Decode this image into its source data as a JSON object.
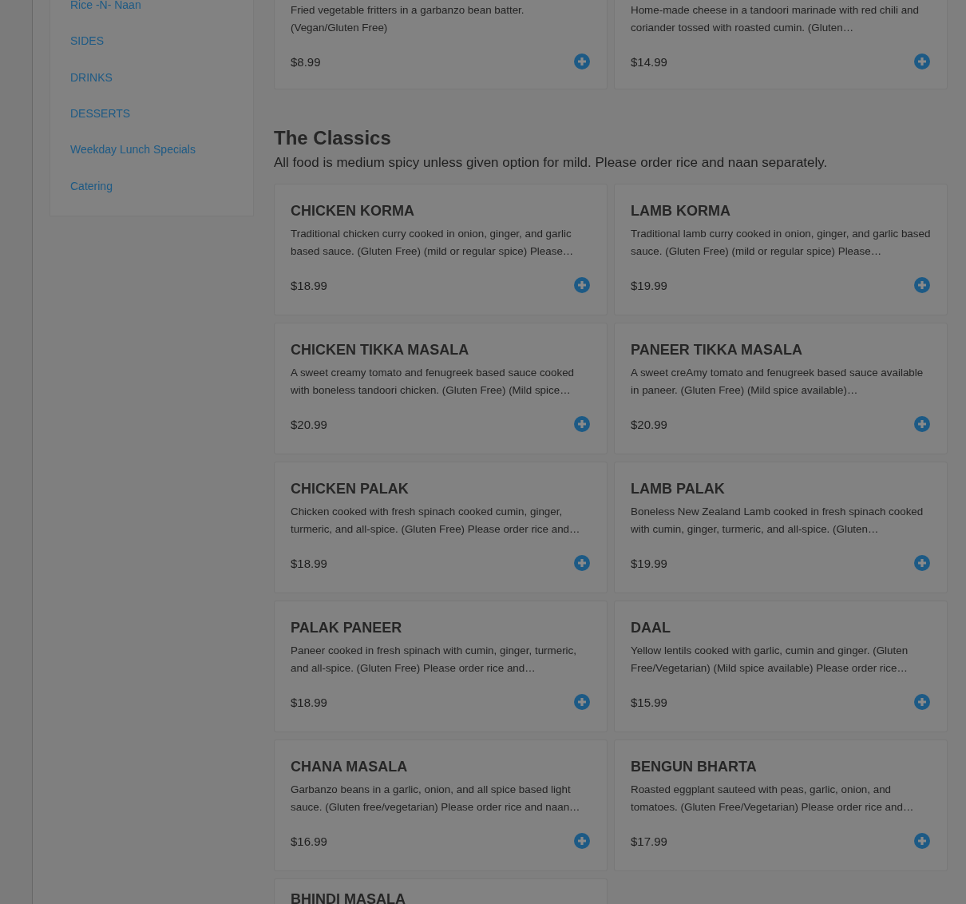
{
  "sidebar": {
    "items": [
      {
        "label": "Rice -N- Naan"
      },
      {
        "label": "SIDES"
      },
      {
        "label": "DRINKS"
      },
      {
        "label": "DESSERTS"
      },
      {
        "label": "Weekday Lunch Specials"
      },
      {
        "label": "Catering"
      }
    ]
  },
  "top_items": [
    {
      "description": "Fried vegetable fritters in a garbanzo bean batter. (Vegan/Gluten Free)",
      "price": "$8.99"
    },
    {
      "description": "Home-made cheese in a tandoori marinade with red chili and coriander tossed with roasted cumin. (Gluten…",
      "price": "$14.99"
    }
  ],
  "section": {
    "title": "The Classics",
    "subtitle": "All food is medium spicy unless given option for mild. Please order rice and naan separately.",
    "items": [
      {
        "name": "CHICKEN KORMA",
        "description": "Traditional chicken curry cooked in onion, ginger, and garlic based sauce. (Gluten Free) (mild or regular spice) Please…",
        "price": "$18.99"
      },
      {
        "name": "LAMB KORMA",
        "description": "Traditional lamb curry cooked in onion, ginger, and garlic based sauce. (Gluten Free) (mild or regular spice) Please…",
        "price": "$19.99"
      },
      {
        "name": "CHICKEN TIKKA MASALA",
        "description": "A sweet creamy tomato and fenugreek based sauce cooked with boneless tandoori chicken. (Gluten Free) (Mild spice…",
        "price": "$20.99"
      },
      {
        "name": "PANEER TIKKA MASALA",
        "description": "A sweet creAmy tomato and fenugreek based sauce available in paneer. (Gluten Free) (Mild spice available)…",
        "price": "$20.99"
      },
      {
        "name": "CHICKEN PALAK",
        "description": "Chicken cooked with fresh spinach cooked cumin, ginger, turmeric, and all-spice. (Gluten Free) Please order rice and…",
        "price": "$18.99"
      },
      {
        "name": "LAMB PALAK",
        "description": "Boneless New Zealand Lamb cooked in fresh spinach cooked with cumin, ginger, turmeric, and all-spice. (Gluten…",
        "price": "$19.99"
      },
      {
        "name": "PALAK PANEER",
        "description": "Paneer cooked in fresh spinach with cumin, ginger, turmeric, and all-spice. (Gluten Free) Please order rice and…",
        "price": "$18.99"
      },
      {
        "name": "DAAL",
        "description": "Yellow lentils cooked with garlic, cumin and ginger. (Gluten Free/Vegetarian) (Mild spice available) Please order rice…",
        "price": "$15.99"
      },
      {
        "name": "CHANA MASALA",
        "description": "Garbanzo beans in a garlic, onion, and all spice based light sauce. (Gluten free/vegetarian) Please order rice and naan…",
        "price": "$16.99"
      },
      {
        "name": "BENGUN BHARTA",
        "description": "Roasted eggplant sauteed with peas, garlic, onion, and tomatoes. (Gluten Free/Vegetarian) Please order rice and…",
        "price": "$17.99"
      },
      {
        "name": "BHINDI MASALA"
      }
    ]
  }
}
